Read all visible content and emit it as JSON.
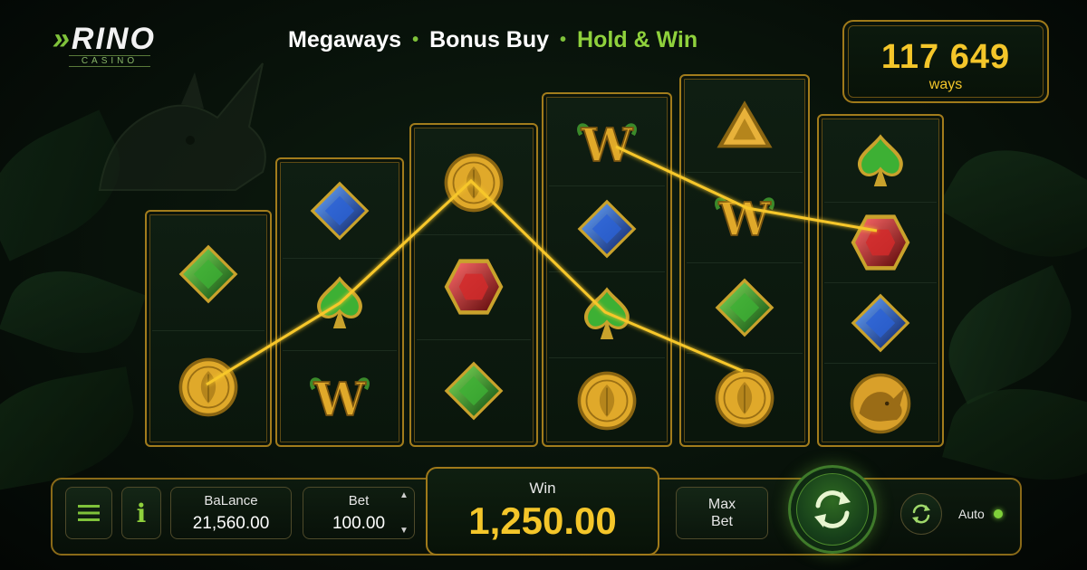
{
  "logo": {
    "name": "RINO",
    "sub": "CASINO"
  },
  "features": [
    "Megaways",
    "Bonus Buy",
    "Hold & Win"
  ],
  "ways": {
    "value": "117 649",
    "label": "ways"
  },
  "reels": [
    {
      "symbols": [
        "green-gem",
        "gold-coin"
      ]
    },
    {
      "symbols": [
        "blue-gem",
        "green-spade",
        "wild-w"
      ]
    },
    {
      "symbols": [
        "gold-coin",
        "red-gem",
        "green-gem"
      ]
    },
    {
      "symbols": [
        "wild-w",
        "blue-gem",
        "green-spade",
        "gold-coin"
      ]
    },
    {
      "symbols": [
        "gold-triangle",
        "wild-w",
        "green-gem",
        "gold-coin"
      ]
    },
    {
      "symbols": [
        "green-spade",
        "red-gem",
        "blue-gem",
        "rhino-coin"
      ]
    }
  ],
  "controls": {
    "balance_label": "BaLance",
    "balance_value": "21,560.00",
    "bet_label": "Bet",
    "bet_value": "100.00",
    "win_label": "Win",
    "win_value": "1,250.00",
    "max_bet_line1": "Max",
    "max_bet_line2": "Bet",
    "auto_label": "Auto"
  },
  "colors": {
    "gold": "#f4c62a",
    "green_accent": "#7fc23a",
    "frame": "#a27c1c"
  }
}
